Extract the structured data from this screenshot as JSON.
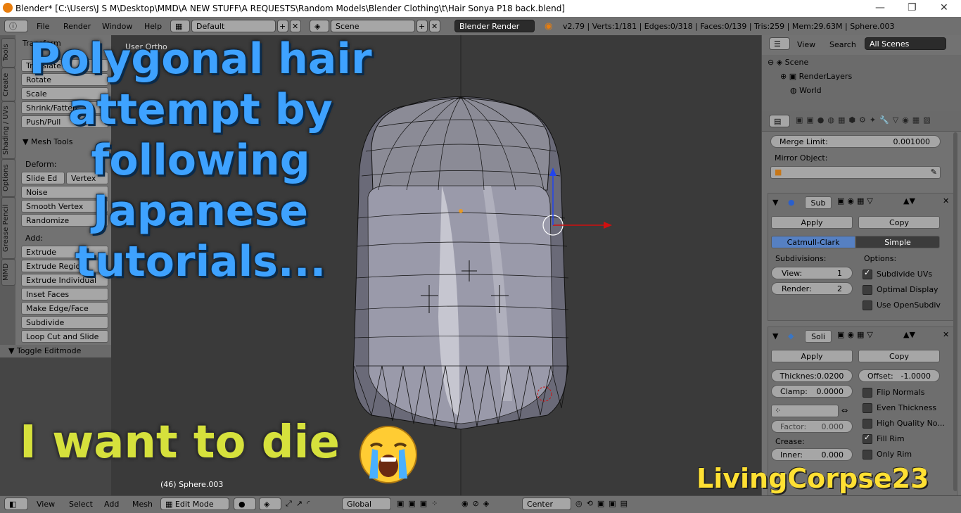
{
  "window": {
    "title": "Blender* [C:\\Users\\J S M\\Desktop\\MMD\\A NEW STUFF\\A REQUESTS\\Random Models\\Blender Clothing\\t\\Hair Sonya P18 back.blend]",
    "minimize": "—",
    "maximize": "❐",
    "close": "✕"
  },
  "topbar": {
    "menus": [
      "File",
      "Render",
      "Window",
      "Help"
    ],
    "layout": "Default",
    "scene": "Scene",
    "engine": "Blender Render",
    "stats": "v2.79 | Verts:1/181 | Edges:0/318 | Faces:0/139 | Tris:259 | Mem:29.63M | Sphere.003"
  },
  "tool_tabs": [
    "Tools",
    "Create",
    "Shading / UVs",
    "Options",
    "Grease Pencil",
    "MMD"
  ],
  "tools": {
    "transform_header": "Transform",
    "transform": [
      "Translate",
      "Rotate",
      "Scale",
      "Shrink/Fatten",
      "Push/Pull"
    ],
    "mesh_tools_header": "Mesh Tools",
    "deform_label": "Deform:",
    "deform_row": [
      "Slide Ed",
      "Vertex"
    ],
    "deform": [
      "Noise",
      "Smooth Vertex",
      "Randomize"
    ],
    "add_label": "Add:",
    "extrude": "Extrude",
    "add": [
      "Extrude Region",
      "Extrude Individual",
      "Inset Faces",
      "Make Edge/Face",
      "Subdivide",
      "Loop Cut and Slide"
    ],
    "toggle_editmode": "Toggle Editmode"
  },
  "viewport": {
    "view_label": "User Ortho",
    "object_info": "(46) Sphere.003"
  },
  "outliner": {
    "view": "View",
    "search": "Search",
    "filter": "All Scenes",
    "items": [
      "Scene",
      "RenderLayers",
      "World"
    ]
  },
  "properties": {
    "merge_limit_label": "Merge Limit:",
    "merge_limit_value": "0.001000",
    "mirror_object_label": "Mirror Object:",
    "subsurf": {
      "name": "Sub",
      "apply": "Apply",
      "copy": "Copy",
      "catmull": "Catmull-Clark",
      "simple": "Simple",
      "subdivisions_label": "Subdivisions:",
      "options_label": "Options:",
      "view_label": "View:",
      "view_value": "1",
      "render_label": "Render:",
      "render_value": "2",
      "opt_subdivide_uvs": "Subdivide UVs",
      "opt_optimal_display": "Optimal Display",
      "opt_use_opensubdiv": "Use OpenSubdiv"
    },
    "solidify": {
      "name": "Soli",
      "apply": "Apply",
      "copy": "Copy",
      "thickness": "Thicknes:0.0200",
      "offset": "Offset:",
      "offset_value": "-1.0000",
      "clamp": "Clamp:",
      "clamp_value": "0.0000",
      "factor": "Factor:",
      "factor_value": "0.000",
      "crease_label": "Crease:",
      "inner": "Inner:",
      "inner_value": "0.000",
      "flip_normals": "Flip Normals",
      "even_thickness": "Even Thickness",
      "high_quality": "High Quality No...",
      "fill_rim": "Fill Rim",
      "only_rim": "Only Rim"
    }
  },
  "bottombar": {
    "view": "View",
    "select": "Select",
    "add": "Add",
    "mesh": "Mesh",
    "mode": "Edit Mode",
    "orientation": "Global",
    "pivot": "Center"
  },
  "overlay": {
    "caption_lines": [
      "Polygonal hair",
      "attempt by",
      "following",
      "Japanese",
      "tutorials..."
    ],
    "sad_text": "I want to die",
    "author": "LivingCorpse23"
  },
  "colors": {
    "caption": "#3ea2ff",
    "sad": "#d6e13c",
    "author": "#ffe033",
    "accent": "#5680c2"
  }
}
